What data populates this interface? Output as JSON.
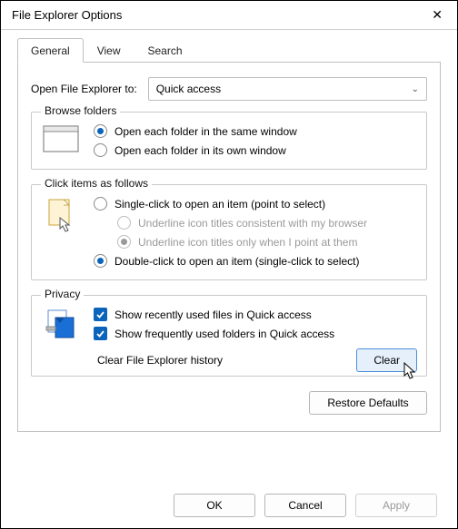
{
  "window": {
    "title": "File Explorer Options"
  },
  "tabs": {
    "general": "General",
    "view": "View",
    "search": "Search"
  },
  "open_to": {
    "label": "Open File Explorer to:",
    "value": "Quick access"
  },
  "browse": {
    "legend": "Browse folders",
    "same": "Open each folder in the same window",
    "own": "Open each folder in its own window"
  },
  "click": {
    "legend": "Click items as follows",
    "single": "Single-click to open an item (point to select)",
    "ul_browser": "Underline icon titles consistent with my browser",
    "ul_point": "Underline icon titles only when I point at them",
    "double": "Double-click to open an item (single-click to select)"
  },
  "privacy": {
    "legend": "Privacy",
    "recent_files": "Show recently used files in Quick access",
    "freq_folders": "Show frequently used folders in Quick access",
    "clear_label": "Clear File Explorer history",
    "clear_btn": "Clear"
  },
  "restore": "Restore Defaults",
  "ok": "OK",
  "cancel": "Cancel",
  "apply": "Apply"
}
